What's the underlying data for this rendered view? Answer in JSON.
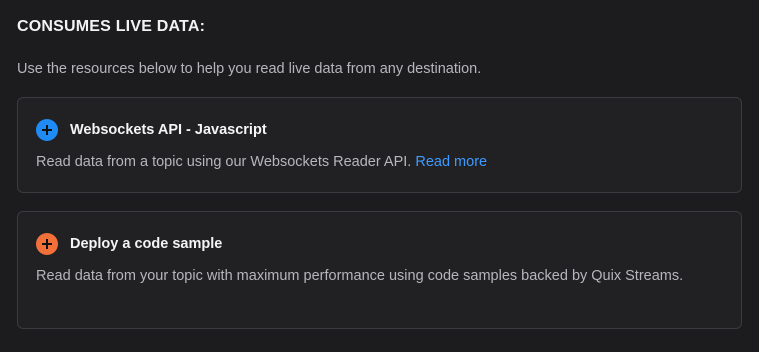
{
  "section": {
    "heading": "CONSUMES LIVE DATA:",
    "intro": "Use the resources below to help you read live data from any destination."
  },
  "cards": [
    {
      "title": "Websockets API - Javascript",
      "description": "Read data from a topic using our Websockets Reader API.",
      "link_label": "Read more",
      "icon": "plus-circle-icon",
      "icon_color": "#1f8bf5"
    },
    {
      "title": "Deploy a code sample",
      "description": "Read data from your topic with maximum performance using code samples backed by Quix Streams.",
      "icon": "plus-circle-icon",
      "icon_color": "#f2703a"
    }
  ],
  "colors": {
    "background": "#1c1c1e",
    "card_background": "#212124",
    "card_border": "#3a3a3f",
    "link": "#3d9bff"
  }
}
